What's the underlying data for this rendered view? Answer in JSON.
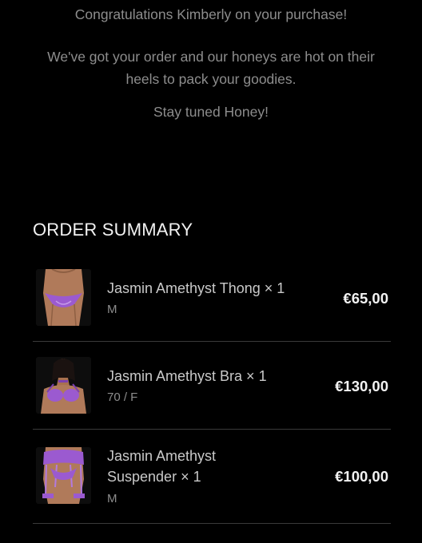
{
  "intro": {
    "line1": "Congratulations Kimberly on your purchase!",
    "line2a": "We've got your order and our honeys are hot on their",
    "line2b": "heels to pack your goodies.",
    "line3": "Stay tuned Honey!"
  },
  "order_summary": {
    "title": "ORDER SUMMARY",
    "items": [
      {
        "name": "Jasmin Amethyst Thong × 1",
        "variant": "M",
        "price": "€65,00",
        "image": "thong-product-photo"
      },
      {
        "name": "Jasmin Amethyst Bra × 1",
        "variant": "70 / F",
        "price": "€130,00",
        "image": "bra-product-photo"
      },
      {
        "name_line1": "Jasmin Amethyst",
        "name_line2": "Suspender × 1",
        "variant": "M",
        "price": "€100,00",
        "image": "suspender-product-photo"
      }
    ]
  },
  "colors": {
    "background": "#000000",
    "accent": "#a35fd6",
    "muted_text": "#8d8d8d",
    "title_text": "#f2f2f2",
    "divider": "#3a3a3a"
  }
}
